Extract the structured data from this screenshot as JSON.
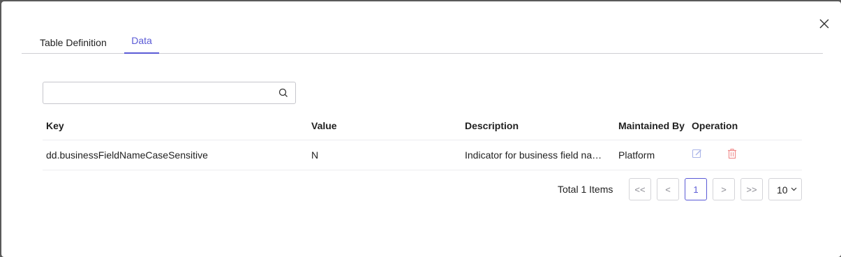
{
  "tabs": [
    {
      "label": "Table Definition"
    },
    {
      "label": "Data",
      "active": true
    }
  ],
  "search": {
    "placeholder": "",
    "value": ""
  },
  "table": {
    "headers": [
      "Key",
      "Value",
      "Description",
      "Maintained By",
      "Operation"
    ],
    "rows": [
      {
        "key": "dd.businessFieldNameCaseSensitive",
        "value": "N",
        "description": "Indicator for business field na…",
        "maintained_by": "Platform"
      }
    ]
  },
  "pagination": {
    "total_label": "Total 1 Items",
    "first": "<<",
    "prev": "<",
    "current": "1",
    "next": ">",
    "last": ">>",
    "page_size": "10"
  },
  "colors": {
    "accent": "#5b5bd6",
    "edit_icon": "#a9b4e8",
    "delete_icon": "#f08a8a"
  },
  "icons": [
    "close-icon",
    "search-icon",
    "edit-icon",
    "delete-icon",
    "chevron-down-icon"
  ]
}
